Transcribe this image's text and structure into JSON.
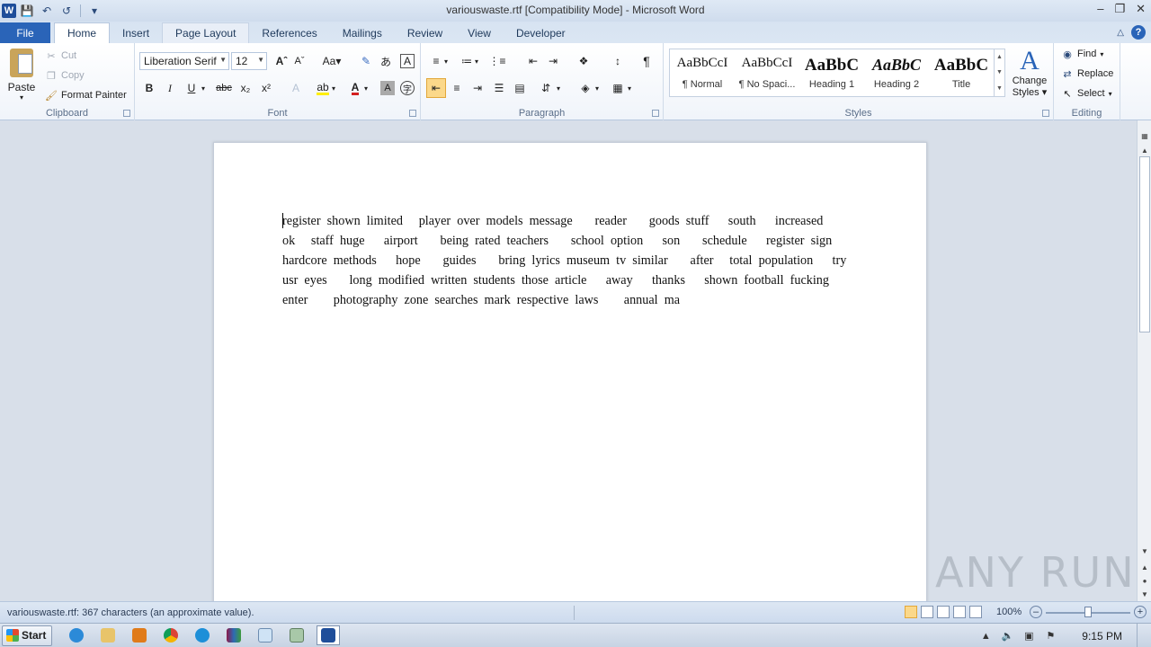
{
  "window": {
    "title": "variouswaste.rtf [Compatibility Mode]  -  Microsoft Word",
    "app_logo": "W"
  },
  "ribbon_tabs": [
    "File",
    "Home",
    "Insert",
    "Page Layout",
    "References",
    "Mailings",
    "Review",
    "View",
    "Developer"
  ],
  "active_tab": "Home",
  "clipboard": {
    "paste": "Paste",
    "cut": "Cut",
    "copy": "Copy",
    "format_painter": "Format Painter",
    "label": "Clipboard"
  },
  "font": {
    "font_name": "Liberation Serif",
    "font_size": "12",
    "label": "Font"
  },
  "paragraph": {
    "label": "Paragraph"
  },
  "styles": {
    "items": [
      {
        "sample": "AaBbCcI",
        "name": "¶ Normal"
      },
      {
        "sample": "AaBbCcI",
        "name": "¶ No Spaci..."
      },
      {
        "sample": "AaBbC",
        "name": "Heading 1"
      },
      {
        "sample": "AaBbC",
        "name": "Heading 2"
      },
      {
        "sample": "AaBbC",
        "name": "Title"
      }
    ],
    "change_styles_line1": "Change",
    "change_styles_line2": "Styles",
    "label": "Styles"
  },
  "editing": {
    "find": "Find",
    "replace": "Replace",
    "select": "Select",
    "label": "Editing"
  },
  "document": {
    "lines": [
      "register  shown  limited     player  over  models  message       reader       goods  stuff      south      increased",
      "ok     staff  huge      airport       being  rated  teachers       school  option      son       schedule      register  sign",
      "hardcore  methods      hope       guides       bring  lyrics  museum  tv  similar       after     total  population      try",
      "usr  eyes       long  modified  written  students  those  article      away      thanks      shown  football  fucking",
      "enter        photography  zone  searches  mark  respective  laws        annual  ma"
    ]
  },
  "status": {
    "text": "variouswaste.rtf: 367 characters (an approximate value).",
    "zoom": "100%",
    "zoom_level_percent": 100
  },
  "watermark": "ANY RUN",
  "taskbar": {
    "start": "Start",
    "clock": "9:15 PM",
    "apps": [
      "internet-explorer",
      "file-explorer",
      "media-player",
      "chrome",
      "edge",
      "winrar",
      "notepad",
      "generic-app",
      "word"
    ]
  }
}
